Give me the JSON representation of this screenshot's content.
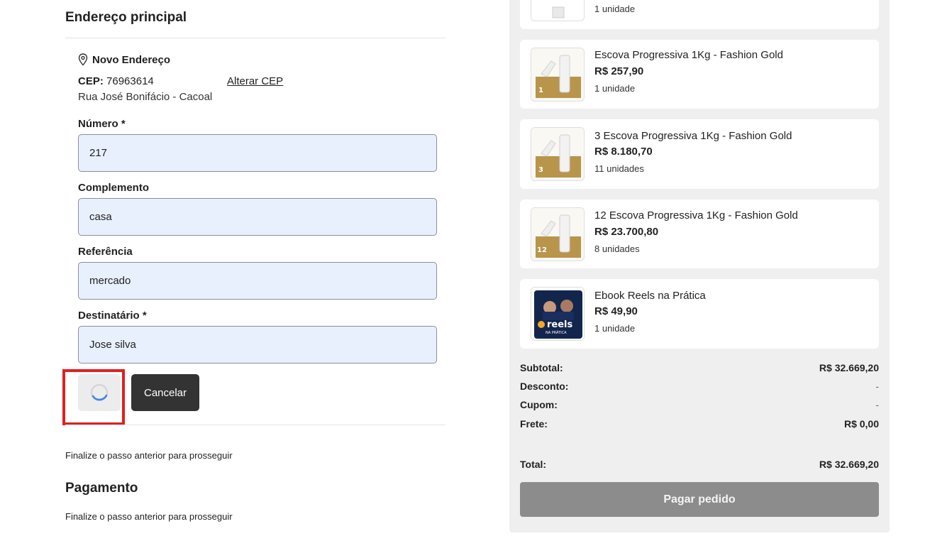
{
  "address": {
    "section_title": "Endereço principal",
    "new_address_label": "Novo Endereço",
    "cep_label": "CEP:",
    "cep_value": "76963614",
    "change_cep_link": "Alterar CEP",
    "street": "Rua José Bonifácio - Cacoal",
    "fields": {
      "numero": {
        "label": "Número *",
        "value": "217"
      },
      "complemento": {
        "label": "Complemento",
        "value": "casa"
      },
      "referencia": {
        "label": "Referência",
        "value": "mercado"
      },
      "destinatario": {
        "label": "Destinatário *",
        "value": "Jose silva"
      }
    },
    "cancel_label": "Cancelar"
  },
  "shipping_note": "Finalize o passo anterior para prosseguir",
  "payment": {
    "section_title": "Pagamento",
    "note": "Finalize o passo anterior para prosseguir"
  },
  "cart": {
    "items": [
      {
        "name": "",
        "price": "",
        "qty": "1 unidade"
      },
      {
        "name": "Escova Progressiva 1Kg - Fashion Gold",
        "price": "R$ 257,90",
        "qty": "1 unidade",
        "badge": "1"
      },
      {
        "name": "3 Escova Progressiva 1Kg - Fashion Gold",
        "price": "R$ 8.180,70",
        "qty": "11 unidades",
        "badge": "3"
      },
      {
        "name": "12 Escova Progressiva 1Kg - Fashion Gold",
        "price": "R$ 23.700,80",
        "qty": "8 unidades",
        "badge": "12"
      },
      {
        "name": "Ebook Reels na Prática",
        "price": "R$ 49,90",
        "qty": "1 unidade",
        "badge": "reels"
      }
    ],
    "summary": {
      "subtotal_label": "Subtotal:",
      "subtotal_value": "R$ 32.669,20",
      "desconto_label": "Desconto:",
      "desconto_value": "-",
      "cupom_label": "Cupom:",
      "cupom_value": "-",
      "frete_label": "Frete:",
      "frete_value": "R$ 0,00",
      "total_label": "Total:",
      "total_value": "R$ 32.669,20"
    },
    "pay_button": "Pagar pedido"
  },
  "colors": {
    "input_bg": "#e8f0fe",
    "highlight": "#e02020",
    "cancel_bg": "#333333",
    "pay_bg": "#8c8c8c",
    "spinner": "#3b82f6",
    "panel_bg": "#efefef"
  }
}
